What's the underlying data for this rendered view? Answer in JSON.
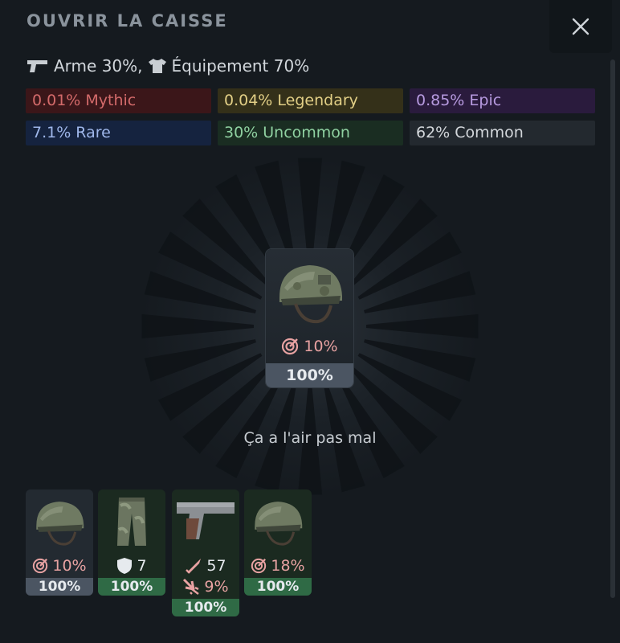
{
  "header": {
    "title": "OUVRIR LA CAISSE",
    "close_icon": "close-icon"
  },
  "split": {
    "weapon": "Arme 30%,",
    "equipment": "Équipement 70%"
  },
  "rarities": [
    {
      "label": "0.01% Mythic",
      "bg": "#3b1619",
      "fg": "#d36a6a"
    },
    {
      "label": "0.04% Legendary",
      "bg": "#343019",
      "fg": "#e2cf86"
    },
    {
      "label": "0.85% Epic",
      "bg": "#2a1b3d",
      "fg": "#b79ae0"
    },
    {
      "label": "7.1% Rare",
      "bg": "#15233f",
      "fg": "#9fb7ea"
    },
    {
      "label": "30% Uncommon",
      "bg": "#1a2d22",
      "fg": "#8fd1a1"
    },
    {
      "label": "62% Common",
      "bg": "#23292f",
      "fg": "#d3d7db"
    }
  ],
  "reward": {
    "item": "helmet",
    "stat_icon": "target-icon",
    "stat": "10%",
    "condition": "100%"
  },
  "caption": "Ça a l'air pas mal",
  "inventory": [
    {
      "item": "helmet",
      "stat_icon": "target-icon",
      "stat": "10%",
      "condition": "100%",
      "rarity": "common"
    },
    {
      "item": "pants",
      "stat_icon": "shield-icon",
      "stat": "7",
      "condition": "100%",
      "rarity": "uncommon"
    },
    {
      "item": "pistol",
      "stat_icon": "bullet-icon",
      "stat": "57",
      "stat2_icon": "crit-icon",
      "stat2": "9%",
      "condition": "100%",
      "rarity": "uncommon"
    },
    {
      "item": "helmet",
      "stat_icon": "target-icon",
      "stat": "18%",
      "condition": "100%",
      "rarity": "uncommon"
    }
  ],
  "colors": {
    "common_bar": "#4b5562",
    "uncommon_bar": "#2f6a45",
    "uncommon_bg": "#1b2a20",
    "common_bg": "#232a31"
  }
}
